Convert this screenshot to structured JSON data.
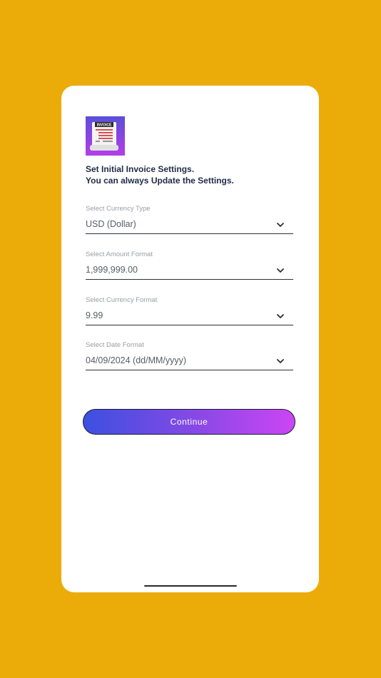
{
  "app": {
    "logo_icon": "invoice-document-icon",
    "logo_text": "INVOICE",
    "colors": {
      "background": "#EBAC0A",
      "card": "#FFFFFF",
      "heading": "#1F2A44",
      "button_gradient_start": "#3C50DF",
      "button_gradient_end": "#CC46F4"
    }
  },
  "heading": {
    "line1": "Set Initial Invoice Settings.",
    "line2": "You can always Update the Settings."
  },
  "fields": [
    {
      "label": "Select Currency Type",
      "value": "USD (Dollar)"
    },
    {
      "label": "Select Amount Format",
      "value": "1,999,999.00"
    },
    {
      "label": "Select Currency Format",
      "value": "9.99"
    },
    {
      "label": "Select Date Format",
      "value": "04/09/2024 (dd/MM/yyyy)"
    }
  ],
  "continue_button": {
    "label": "Continue"
  }
}
